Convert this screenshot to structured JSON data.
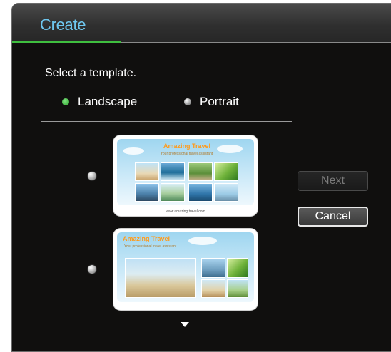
{
  "window": {
    "title": "Create"
  },
  "prompt": "Select a template.",
  "orientation": {
    "options": [
      {
        "label": "Landscape",
        "selected": true
      },
      {
        "label": "Portrait",
        "selected": false
      }
    ]
  },
  "templates": [
    {
      "title": "Amazing Travel",
      "subtitle": "Your professional travel assistant",
      "footer": "www.amazing travel.com",
      "selected": false
    },
    {
      "title": "Amazing Travel",
      "subtitle": "Your professional travel assistant",
      "selected": false
    }
  ],
  "buttons": {
    "next_label": "Next",
    "next_enabled": false,
    "cancel_label": "Cancel"
  },
  "colors": {
    "accent_green": "#3fbf3f",
    "title_blue": "#6ec6ee",
    "template_title_orange": "#ff9a1a"
  }
}
